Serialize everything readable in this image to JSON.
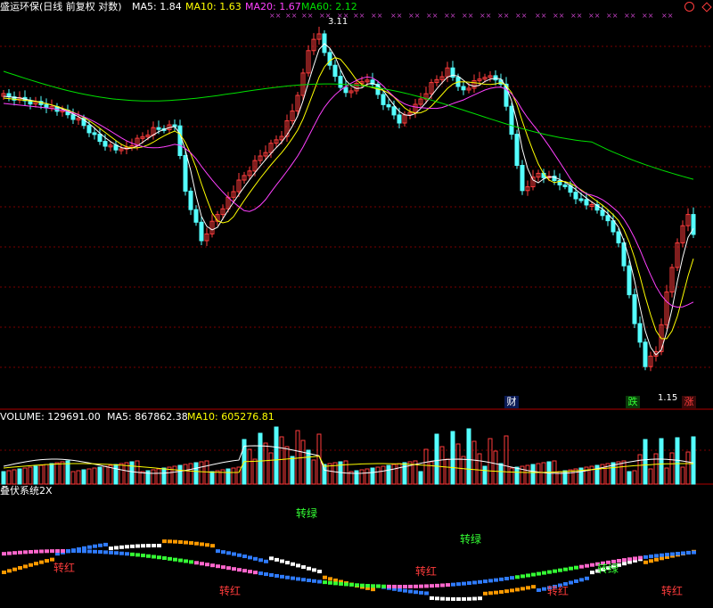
{
  "header": {
    "title": "盛运环保(日线 前复权 对数)",
    "ma5": "MA5: 1.84",
    "ma10": "MA10: 1.63",
    "ma20": "MA20: 1.67",
    "ma60": "MA60: 2.12"
  },
  "volume_header": {
    "label": "VOLUME: 129691.00",
    "ma5": "MA5: 867862.38",
    "ma10": "MA10: 605276.81"
  },
  "indicator_header": {
    "label": "叠伏系统2X"
  },
  "annotations": {
    "high_price": "3.11",
    "low_price": "1.15",
    "badge_cai": "财",
    "badge_die": "跌",
    "badge_zhang": "涨",
    "turn_red": "转红",
    "turn_green": "转绿"
  },
  "colors": {
    "up": "#ff3c3c",
    "down": "#54ffff",
    "ma5": "#ffffff",
    "ma10": "#ffff00",
    "ma20": "#ff40ff",
    "ma60": "#00e000",
    "grid": "#7a0000",
    "orange": "#ff9a00",
    "blue": "#2f7bff",
    "pink": "#ff66cc"
  },
  "chart_data": {
    "type": "candlestick",
    "title": "盛运环保(日线 前复权 对数)",
    "scale": "log",
    "visible_high": 3.11,
    "visible_low": 1.15,
    "moving_averages": {
      "MA5": 1.84,
      "MA10": 1.63,
      "MA20": 1.67,
      "MA60": 2.12
    },
    "volume": {
      "current": 129691.0,
      "MA5": 867862.38,
      "MA10": 605276.81
    }
  }
}
